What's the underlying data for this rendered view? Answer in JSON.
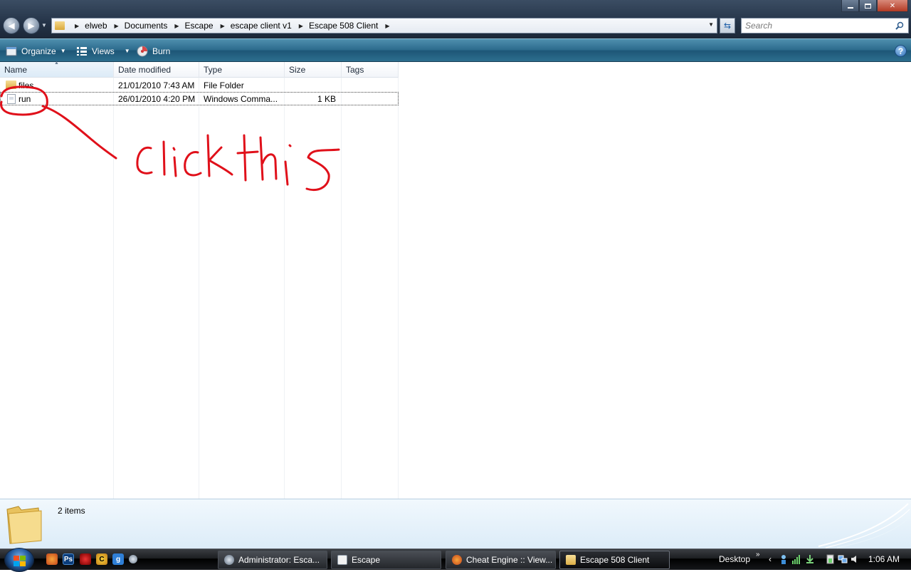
{
  "window": {
    "controls": {
      "minimize": "minimize",
      "maximize": "maximize",
      "close": "✕"
    }
  },
  "address": {
    "crumbs": [
      "elweb",
      "Documents",
      "Escape",
      "escape client v1",
      "Escape 508 Client"
    ]
  },
  "search": {
    "placeholder": "Search"
  },
  "toolbar": {
    "organize": "Organize",
    "views": "Views",
    "burn": "Burn",
    "help": "?"
  },
  "columns": {
    "name": "Name",
    "date": "Date modified",
    "type": "Type",
    "size": "Size",
    "tags": "Tags"
  },
  "files": [
    {
      "name": "files",
      "date": "21/01/2010 7:43 AM",
      "type": "File Folder",
      "size": "",
      "icon": "folder-icon"
    },
    {
      "name": "run",
      "date": "26/01/2010 4:20 PM",
      "type": "Windows Comma...",
      "size": "1 KB",
      "icon": "batch-file-icon",
      "selected": true
    }
  ],
  "annotation": {
    "text": "click this",
    "color": "#e0101a"
  },
  "details": {
    "count": "2 items"
  },
  "taskbar": {
    "tasks": [
      {
        "label": "Administrator:  Esca...",
        "icon": "cmd-icon"
      },
      {
        "label": "Escape",
        "icon": "notepad-icon"
      },
      {
        "label": "Cheat Engine :: View...",
        "icon": "firefox-icon"
      },
      {
        "label": "Escape 508 Client",
        "icon": "folder-icon",
        "active": true
      }
    ],
    "desktop": "Desktop",
    "clock": "1:06 AM"
  }
}
